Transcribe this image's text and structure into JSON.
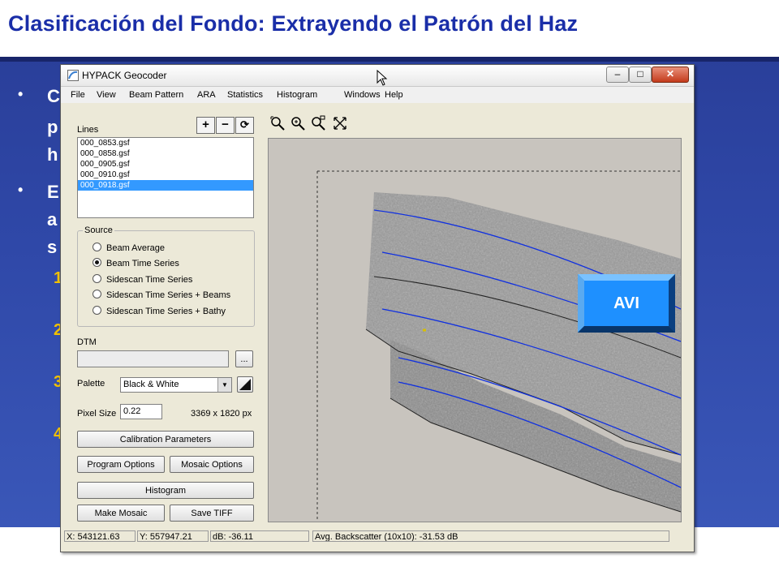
{
  "slide": {
    "title": "Clasificación del Fondo:  Extrayendo el Patrón del Haz",
    "bullet_fragments": [
      "C",
      "p",
      "h",
      "E",
      "a",
      "s"
    ],
    "number_fragments": [
      "1",
      "2",
      "3",
      "4"
    ]
  },
  "window": {
    "title": "HYPACK Geocoder",
    "menu": [
      "File",
      "View",
      "Beam Pattern",
      "ARA",
      "Statistics",
      "Histogram",
      "Windows",
      "Help"
    ]
  },
  "lines": {
    "label": "Lines",
    "items": [
      "000_0853.gsf",
      "000_0858.gsf",
      "000_0905.gsf",
      "000_0910.gsf",
      "000_0918.gsf"
    ],
    "selected_index": 4,
    "buttons": [
      "+",
      "−",
      "⟳"
    ]
  },
  "source": {
    "label": "Source",
    "options": [
      "Beam Average",
      "Beam Time Series",
      "Sidescan Time Series",
      "Sidescan Time Series + Beams",
      "Sidescan Time Series + Bathy"
    ],
    "selected_index": 1
  },
  "dtm": {
    "label": "DTM",
    "value": "",
    "browse_label": "..."
  },
  "palette": {
    "label": "Palette",
    "value": "Black & White"
  },
  "pixel": {
    "label": "Pixel Size",
    "value": "0.22",
    "dimensions": "3369 x 1820 px"
  },
  "buttons": {
    "calibration": "Calibration Parameters",
    "program_options": "Program Options",
    "mosaic_options": "Mosaic Options",
    "histogram": "Histogram",
    "make_mosaic": "Make Mosaic",
    "save_tiff": "Save TIFF"
  },
  "status": {
    "x": "X: 543121.63",
    "y": "Y: 557947.21",
    "db": "dB: -36.11",
    "avg": "Avg. Backscatter (10x10): -31.53 dB"
  },
  "avi_button": {
    "label": "AVI"
  },
  "colors": {
    "slide_title": "#1a2ea8",
    "slide_background": "#2f48a8",
    "numbers": "#f0c000",
    "avi": "#1e90ff",
    "track_lines": "#1030e0",
    "selection": "#3399ff"
  }
}
